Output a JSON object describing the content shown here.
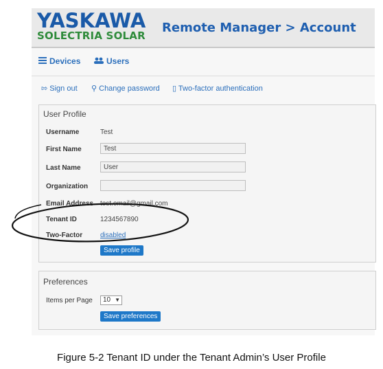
{
  "logo": {
    "line1": "YASKAWA",
    "line2": "SOLECTRIA SOLAR"
  },
  "app_title": "Remote Manager > Account",
  "nav": [
    {
      "icon": "list-icon",
      "label": "Devices"
    },
    {
      "icon": "users-icon",
      "label": "Users"
    }
  ],
  "account_links": [
    {
      "icon": "sign-out-icon",
      "label": "Sign out"
    },
    {
      "icon": "key-icon",
      "label": "Change password"
    },
    {
      "icon": "phone-icon",
      "label": "Two-factor authentication"
    }
  ],
  "profile": {
    "title": "User Profile",
    "username_label": "Username",
    "username": "Test",
    "first_name_label": "First Name",
    "first_name": "Test",
    "last_name_label": "Last Name",
    "last_name": "User",
    "organization_label": "Organization",
    "organization": "",
    "email_label": "Email Address",
    "email": "test.email@gmail.com",
    "tenant_label": "Tenant ID",
    "tenant_id": "1234567890",
    "two_factor_label": "Two-Factor",
    "two_factor": "disabled",
    "save_label": "Save profile"
  },
  "preferences": {
    "title": "Preferences",
    "items_label": "Items per Page",
    "items_value": "10",
    "save_label": "Save preferences"
  },
  "caption": "Figure 5-2 Tenant ID under the Tenant Admin’s User Profile",
  "colors": {
    "brand_blue": "#1a5aa8",
    "brand_green": "#2e8b3a",
    "button": "#1e78c8",
    "link": "#2a6ebb"
  }
}
